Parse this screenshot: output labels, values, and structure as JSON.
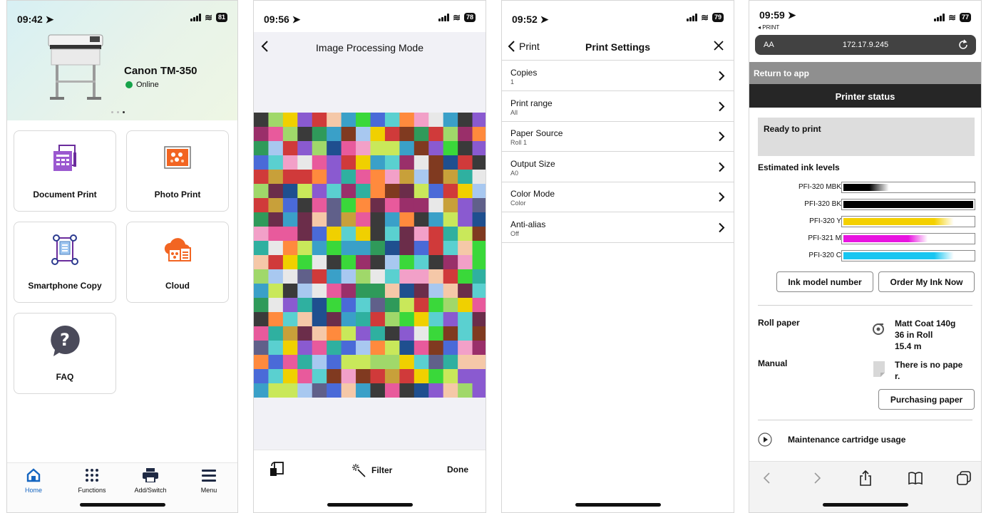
{
  "screens": {
    "home": {
      "time": "09:42",
      "battery": "81",
      "printer": {
        "name": "Canon TM-350",
        "status": "Online"
      },
      "tiles": [
        {
          "label": "Document Print",
          "icon": "document-print-icon"
        },
        {
          "label": "Photo Print",
          "icon": "photo-print-icon"
        },
        {
          "label": "Smartphone Copy",
          "icon": "smartphone-copy-icon"
        },
        {
          "label": "Cloud",
          "icon": "cloud-icon"
        },
        {
          "label": "FAQ",
          "icon": "faq-icon"
        }
      ],
      "tabs": [
        {
          "label": "Home",
          "icon": "home-icon"
        },
        {
          "label": "Functions",
          "icon": "functions-icon"
        },
        {
          "label": "Add/Switch",
          "icon": "printer-icon"
        },
        {
          "label": "Menu",
          "icon": "menu-icon"
        }
      ]
    },
    "image_processing": {
      "time": "09:56",
      "battery": "78",
      "title": "Image Processing Mode",
      "filter_label": "Filter",
      "done_label": "Done"
    },
    "print_settings": {
      "time": "09:52",
      "battery": "79",
      "back_label": "Print",
      "title": "Print Settings",
      "rows": [
        {
          "label": "Copies",
          "value": "1"
        },
        {
          "label": "Print range",
          "value": "All"
        },
        {
          "label": "Paper Source",
          "value": "Roll 1"
        },
        {
          "label": "Output Size",
          "value": "A0"
        },
        {
          "label": "Color Mode",
          "value": "Color"
        },
        {
          "label": "Anti-alias",
          "value": "Off"
        }
      ]
    },
    "printer_status": {
      "time": "09:59",
      "battery": "77",
      "back_app": "PRINT",
      "url_aa": "AA",
      "url": "172.17.9.245",
      "return_label": "Return to app",
      "title": "Printer status",
      "ready": "Ready to print",
      "ink_title": "Estimated ink levels",
      "inks": [
        {
          "name": "PFI-320 MBK",
          "level": 0.35,
          "color": "#000000"
        },
        {
          "name": "PFI-320 BK",
          "level": 1.0,
          "color": "#000000"
        },
        {
          "name": "PFI-320 Y",
          "level": 0.85,
          "color": "#f4d000"
        },
        {
          "name": "PFI-321 M",
          "level": 0.65,
          "color": "#e814e0"
        },
        {
          "name": "PFI-320 C",
          "level": 0.85,
          "color": "#19c6f1"
        }
      ],
      "ink_model_btn": "Ink model number",
      "order_btn": "Order My Ink Now",
      "roll_label": "Roll paper",
      "roll_line1": "Matt Coat 140g",
      "roll_line2": "36 in Roll",
      "roll_line3": "15.4 m",
      "manual_label": "Manual",
      "manual_line1": "There is no pape",
      "manual_line2": "r.",
      "purchase_btn": "Purchasing paper",
      "maintenance": "Maintenance cartridge usage"
    }
  }
}
